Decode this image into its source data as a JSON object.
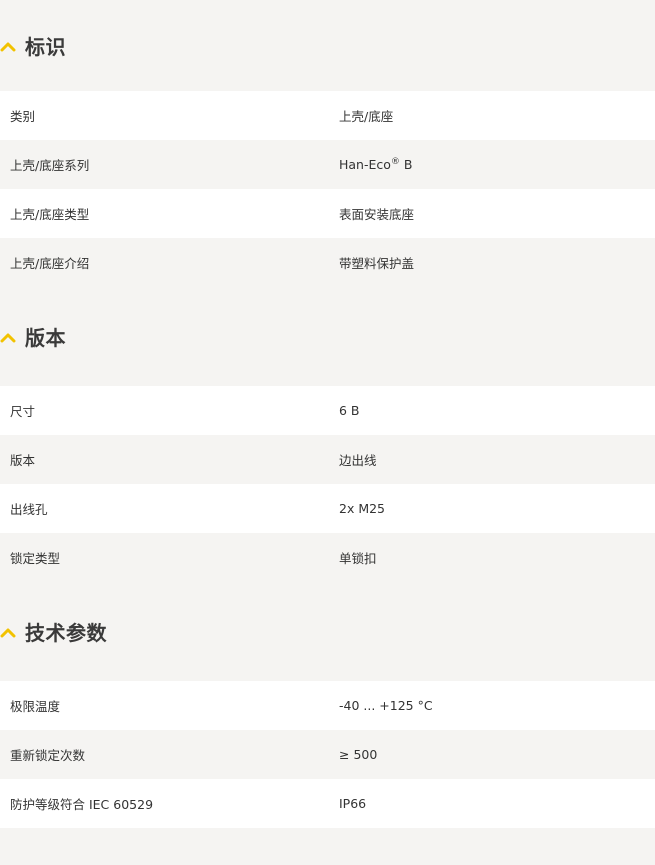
{
  "colors": {
    "accent": "#f2c200",
    "background": "#f5f4f2",
    "row_white": "#ffffff"
  },
  "sections": [
    {
      "title": "标识",
      "icon": "chevron-up-icon",
      "rows": [
        {
          "label": "类别",
          "value": "上壳/底座"
        },
        {
          "label": "上壳/底座系列",
          "value": "Han-Eco",
          "value_sup": "®",
          "value_suffix": " B"
        },
        {
          "label": "上壳/底座类型",
          "value": "表面安装底座"
        },
        {
          "label": "上壳/底座介绍",
          "value": "带塑料保护盖"
        }
      ]
    },
    {
      "title": "版本",
      "icon": "chevron-up-icon",
      "rows": [
        {
          "label": "尺寸",
          "value": "6 B"
        },
        {
          "label": "版本",
          "value": "边出线"
        },
        {
          "label": "出线孔",
          "value": "2x M25"
        },
        {
          "label": "锁定类型",
          "value": "单锁扣"
        }
      ]
    },
    {
      "title": "技术参数",
      "icon": "chevron-up-icon",
      "rows": [
        {
          "label": "极限温度",
          "value": "-40 ... +125 °C"
        },
        {
          "label": "重新锁定次数",
          "value": "≥ 500"
        },
        {
          "label": "防护等级符合 IEC 60529",
          "value": "IP66"
        }
      ]
    }
  ]
}
